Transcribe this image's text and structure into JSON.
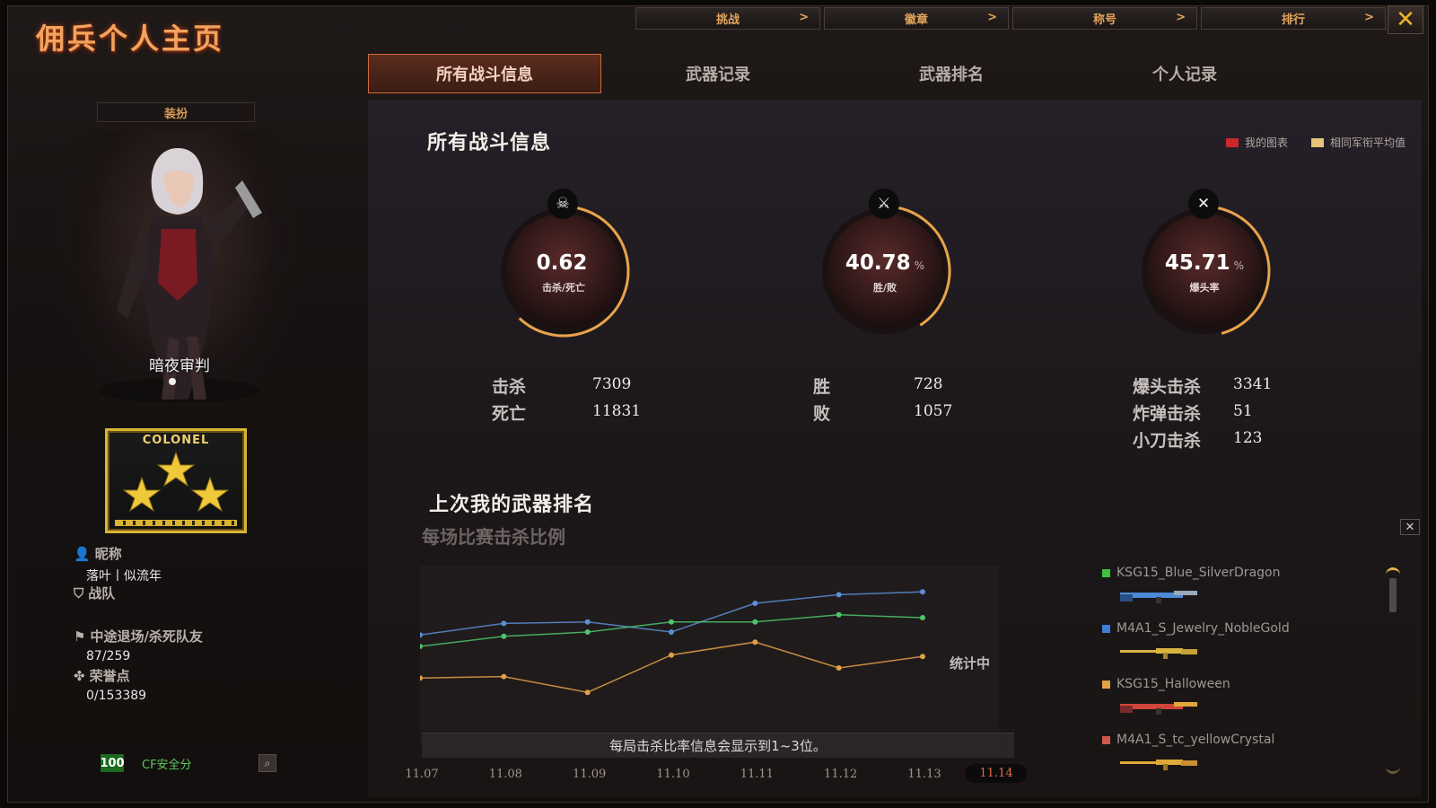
{
  "header": {
    "title": "佣兵个人主页",
    "close_label": "✕"
  },
  "top_nav": [
    {
      "label": "挑战",
      "chevron": ">"
    },
    {
      "label": "徽章",
      "chevron": ">"
    },
    {
      "label": "称号",
      "chevron": ">"
    },
    {
      "label": "排行",
      "chevron": ">"
    }
  ],
  "tabs": [
    {
      "label": "所有战斗信息",
      "active": true
    },
    {
      "label": "武器记录",
      "active": false
    },
    {
      "label": "武器排名",
      "active": false
    },
    {
      "label": "个人记录",
      "active": false
    }
  ],
  "sidebar": {
    "dress_button": "装扮",
    "avatar_caption": "暗夜审判",
    "rank_badge": "COLONEL",
    "nickname_label": "昵称",
    "nickname_value": "落叶丨似流年",
    "team_label": "战队",
    "quit_label": "中途退场/杀死队友",
    "quit_value": "87/259",
    "honor_label": "荣誉点",
    "honor_value": "0/153389",
    "cf_score": "100",
    "cf_label": "CF安全分"
  },
  "main": {
    "section_title": "所有战斗信息",
    "legend": [
      {
        "label": "我的图表",
        "color": "#c9282d"
      },
      {
        "label": "相同军衔平均值",
        "color": "#e8c37a"
      }
    ],
    "gauges": [
      {
        "value": "0.62",
        "unit": "",
        "label": "击杀/死亡",
        "icon": "skull-icon",
        "glyph": "☠",
        "arc": 0.62
      },
      {
        "value": "40.78",
        "unit": "%",
        "label": "胜/败",
        "icon": "crossed-guns-icon",
        "glyph": "⚔",
        "arc": 0.4078
      },
      {
        "value": "45.71",
        "unit": "%",
        "label": "爆头率",
        "icon": "headshot-icon",
        "glyph": "✕",
        "arc": 0.4571
      }
    ],
    "stats_kd": [
      {
        "label": "击杀",
        "value": "7309"
      },
      {
        "label": "死亡",
        "value": "11831"
      }
    ],
    "stats_wl": [
      {
        "label": "胜",
        "value": "728"
      },
      {
        "label": "败",
        "value": "1057"
      }
    ],
    "stats_hs": [
      {
        "label": "爆头击杀",
        "value": "3341"
      },
      {
        "label": "炸弹击杀",
        "value": "51"
      },
      {
        "label": "小刀击杀",
        "value": "123"
      }
    ],
    "weapon_section_title": "上次我的武器排名",
    "chart_subtitle": "每场比赛击杀比例",
    "chart_note": "每局击杀比率信息会显示到1~3位。",
    "chart_status": "统计中"
  },
  "chart_data": {
    "type": "line",
    "x": [
      "11.07",
      "11.08",
      "11.09",
      "11.10",
      "11.11",
      "11.12",
      "11.13",
      "11.14"
    ],
    "selected_x": "11.14",
    "series": [
      {
        "color": "#5a8fd6",
        "values": [
          0.58,
          0.66,
          0.67,
          0.6,
          0.8,
          0.86,
          0.88,
          null
        ]
      },
      {
        "color": "#4cc46a",
        "values": [
          0.5,
          0.57,
          0.6,
          0.67,
          0.67,
          0.72,
          0.7,
          null
        ]
      },
      {
        "color": "#e0a046",
        "values": [
          0.28,
          0.29,
          0.18,
          0.44,
          0.53,
          0.35,
          0.43,
          null
        ]
      }
    ],
    "ylim": [
      0,
      1
    ]
  },
  "weapons": [
    {
      "name": "KSG15_Blue_SilverDragon",
      "color": "#3ec23e",
      "gun_color": "#4a8ad6"
    },
    {
      "name": "M4A1_S_Jewelry_NobleGold",
      "color": "#3a7fd8",
      "gun_color": "#d9b441"
    },
    {
      "name": "KSG15_Halloween",
      "color": "#e0a046",
      "gun_color": "#d0443a"
    },
    {
      "name": "M4A1_S_tc_yellowCrystal",
      "color": "#d05a4a",
      "gun_color": "#e0a83a"
    }
  ],
  "weapon_close_label": "✕"
}
